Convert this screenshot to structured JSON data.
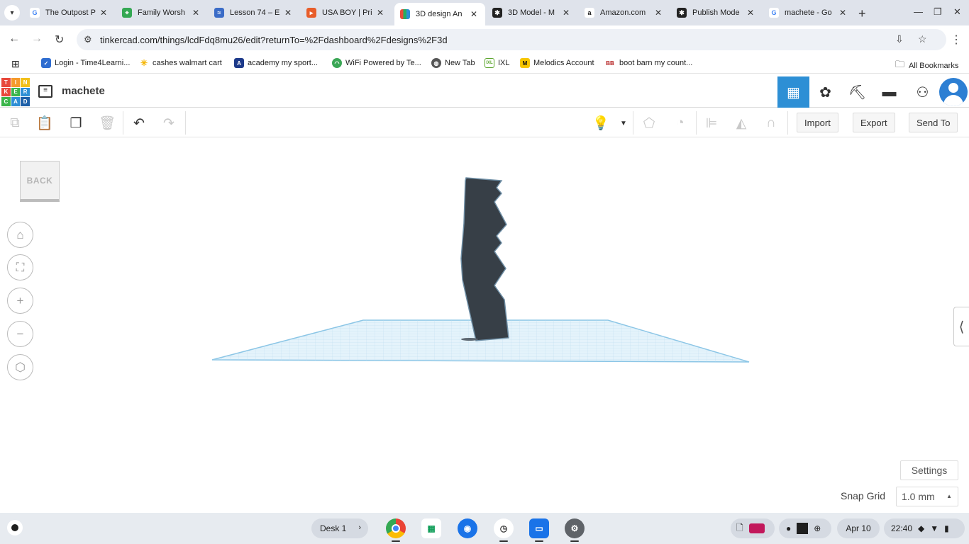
{
  "browser": {
    "tabs": [
      {
        "title": "The Outpost P",
        "icon": "google-icon",
        "active": false
      },
      {
        "title": "Family Worsh",
        "icon": "maps-icon",
        "active": false
      },
      {
        "title": "Lesson 74 – E",
        "icon": "lesson-icon",
        "active": false
      },
      {
        "title": "USA BOY | Pri",
        "icon": "usaboy-icon",
        "active": false
      },
      {
        "title": "3D design An",
        "icon": "tinkercad-icon",
        "active": true
      },
      {
        "title": "3D Model - M",
        "icon": "model-icon",
        "active": false
      },
      {
        "title": "Amazon.com",
        "icon": "amazon-icon",
        "active": false
      },
      {
        "title": "Publish Mode",
        "icon": "publish-icon",
        "active": false
      },
      {
        "title": "machete - Go",
        "icon": "google-icon",
        "active": false
      }
    ],
    "new_tab": "+",
    "url": "tinkercad.com/things/lcdFdq8mu26/edit?returnTo=%2Fdashboard%2Fdesigns%2F3d",
    "bookmarks": [
      {
        "label": "Login - Time4Learni...",
        "icon": "time4learning-icon"
      },
      {
        "label": "cashes walmart cart",
        "icon": "walmart-icon"
      },
      {
        "label": "academy my sport...",
        "icon": "academy-icon"
      },
      {
        "label": "WiFi Powered by Te...",
        "icon": "wifi-icon"
      },
      {
        "label": "New Tab",
        "icon": "globe-icon"
      },
      {
        "label": "IXL",
        "icon": "ixl-icon"
      },
      {
        "label": "Melodics Account",
        "icon": "melodics-icon"
      },
      {
        "label": "boot barn my count...",
        "icon": "bootbarn-icon"
      }
    ],
    "all_bookmarks": "All Bookmarks"
  },
  "tinkercad": {
    "logo_letters": [
      "T",
      "I",
      "N",
      "K",
      "E",
      "R",
      "C",
      "A",
      "D"
    ],
    "design_name": "machete",
    "toolbar": {
      "import": "Import",
      "export": "Export",
      "send_to": "Send To"
    },
    "back_label": "BACK",
    "settings": "Settings",
    "snap_grid_label": "Snap Grid",
    "snap_grid_value": "1.0 mm"
  },
  "shelf": {
    "desk": "Desk 1",
    "date": "Apr 10",
    "time": "22:40"
  },
  "colors": {
    "accent": "#2d8fd5",
    "workplane": "#d7eef9",
    "model": "#373f47"
  }
}
